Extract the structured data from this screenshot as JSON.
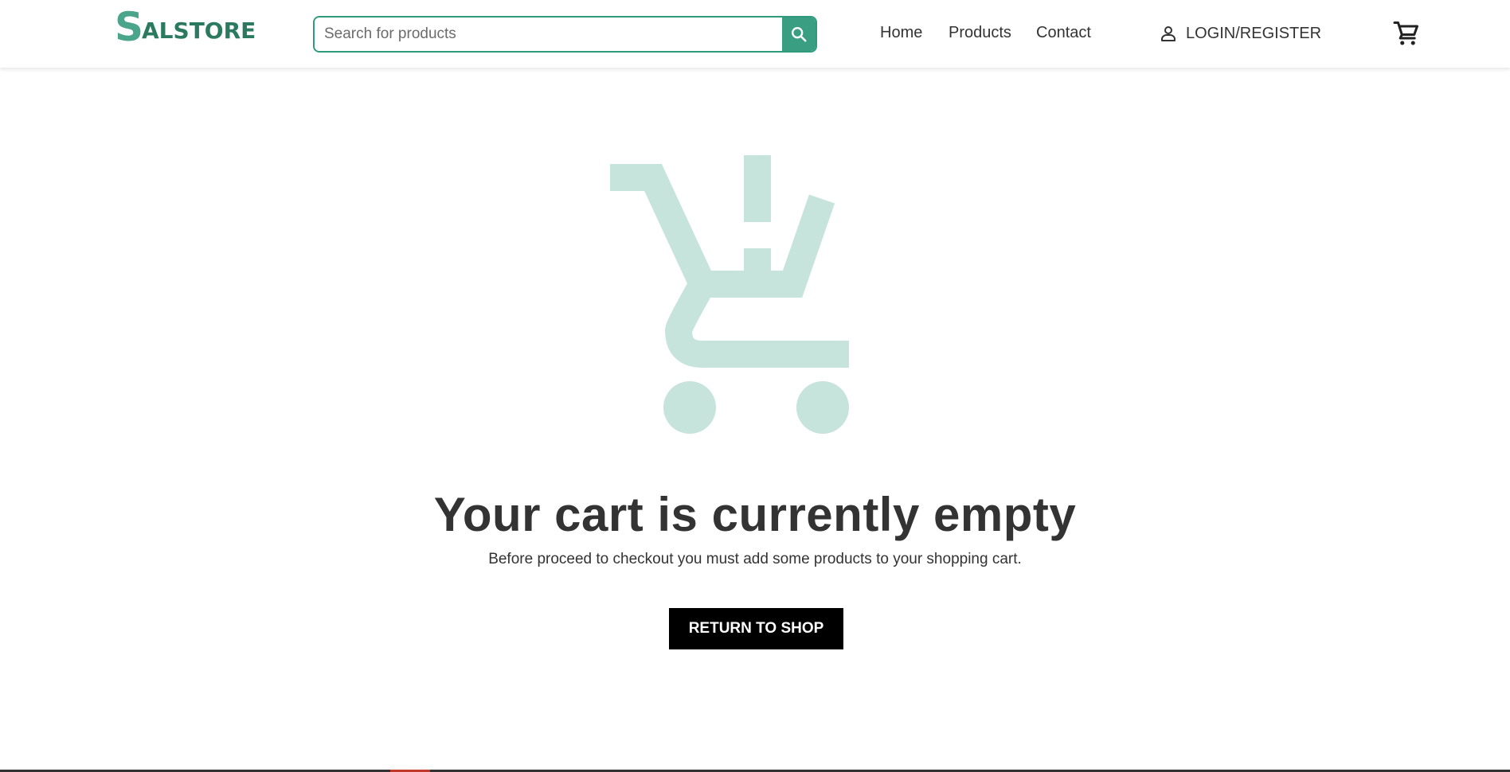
{
  "brand": {
    "logo_initial": "S",
    "logo_rest": "ALSTORE"
  },
  "search": {
    "placeholder": "Search for products",
    "value": ""
  },
  "nav": {
    "home": "Home",
    "products": "Products",
    "contact": "Contact"
  },
  "account": {
    "login_label": "LOGIN/REGISTER"
  },
  "icons": {
    "search": "search-icon",
    "user": "user-icon",
    "cart": "cart-icon",
    "empty_cart": "empty-cart-icon"
  },
  "empty_cart": {
    "title": "Your cart is currently empty",
    "message": "Before proceed to checkout you must add some products to your shopping cart.",
    "button_label": "RETURN TO SHOP"
  },
  "colors": {
    "brand_green": "#3a9e82",
    "brand_dark_green": "#2b7a5f",
    "empty_illustration": "#c6e3dc",
    "button_bg": "#000000",
    "text": "#333333"
  }
}
